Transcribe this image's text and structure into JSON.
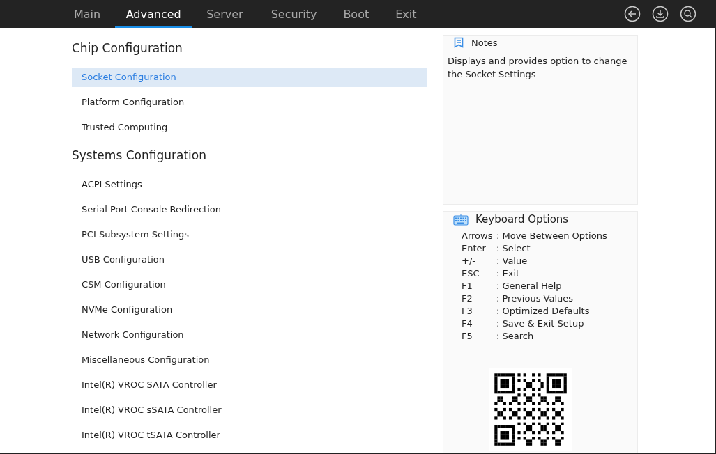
{
  "tabs": [
    {
      "label": "Main",
      "selected": false
    },
    {
      "label": "Advanced",
      "selected": true
    },
    {
      "label": "Server",
      "selected": false
    },
    {
      "label": "Security",
      "selected": false
    },
    {
      "label": "Boot",
      "selected": false
    },
    {
      "label": "Exit",
      "selected": false
    }
  ],
  "sections": [
    {
      "heading": "Chip Configuration",
      "items": [
        {
          "label": "Socket Configuration",
          "selected": true
        },
        {
          "label": "Platform Configuration",
          "selected": false
        },
        {
          "label": "Trusted Computing",
          "selected": false
        }
      ]
    },
    {
      "heading": "Systems Configuration",
      "items": [
        {
          "label": "ACPI Settings",
          "selected": false
        },
        {
          "label": "Serial Port Console Redirection",
          "selected": false
        },
        {
          "label": "PCI Subsystem Settings",
          "selected": false
        },
        {
          "label": "USB Configuration",
          "selected": false
        },
        {
          "label": "CSM Configuration",
          "selected": false
        },
        {
          "label": "NVMe Configuration",
          "selected": false
        },
        {
          "label": "Network Configuration",
          "selected": false
        },
        {
          "label": "Miscellaneous Configuration",
          "selected": false
        },
        {
          "label": "Intel(R) VROC SATA Controller",
          "selected": false
        },
        {
          "label": "Intel(R) VROC sSATA Controller",
          "selected": false
        },
        {
          "label": "Intel(R) VROC tSATA Controller",
          "selected": false
        }
      ]
    }
  ],
  "notes": {
    "title": "Notes",
    "text": "Displays and provides option to change the Socket Settings"
  },
  "keyboard": {
    "title": "Keyboard Options",
    "shortcuts": [
      {
        "key": "Arrows",
        "action": ": Move Between Options"
      },
      {
        "key": "Enter",
        "action": ": Select"
      },
      {
        "key": "+/-",
        "action": ": Value"
      },
      {
        "key": "ESC",
        "action": ": Exit"
      },
      {
        "key": "F1",
        "action": ": General Help"
      },
      {
        "key": "F2",
        "action": ": Previous Values"
      },
      {
        "key": "F3",
        "action": ": Optimized Defaults"
      },
      {
        "key": "F4",
        "action": ": Save & Exit Setup"
      },
      {
        "key": "F5",
        "action": ": Search"
      }
    ]
  }
}
